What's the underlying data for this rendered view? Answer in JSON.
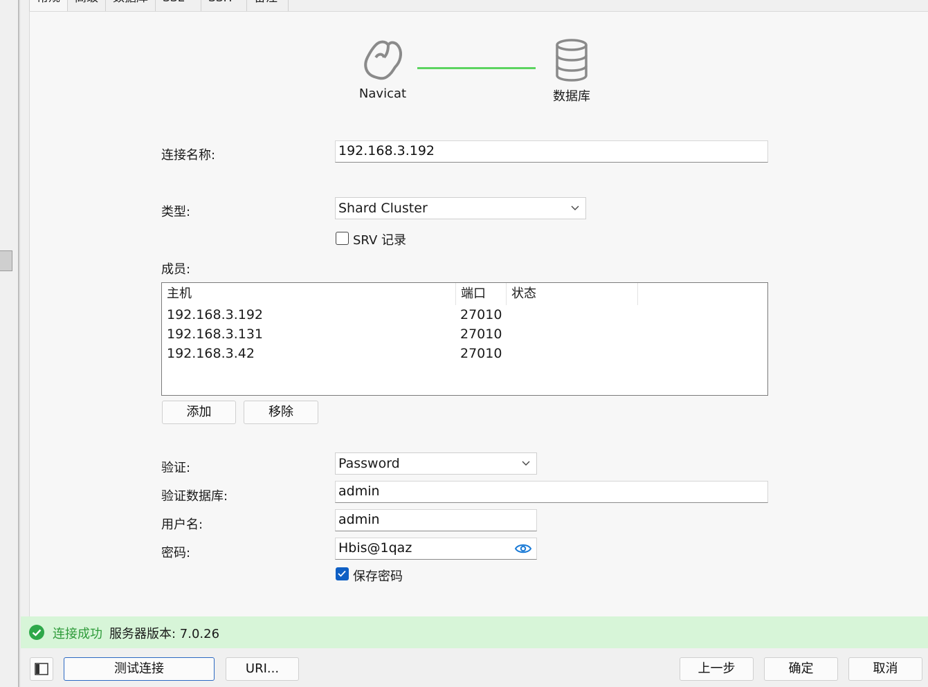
{
  "tabs": [
    "常规",
    "高级",
    "数据库",
    "SSL",
    "SSH",
    "备注"
  ],
  "header": {
    "left_caption": "Navicat",
    "right_caption": "数据库"
  },
  "form": {
    "connection_name_label": "连接名称:",
    "connection_name_value": "192.168.3.192",
    "type_label": "类型:",
    "type_value": "Shard Cluster",
    "srv_label": "SRV 记录",
    "srv_checked": false,
    "members_label": "成员:",
    "members_columns": [
      "主机",
      "端口",
      "状态"
    ],
    "members": [
      {
        "host": "192.168.3.192",
        "port": "27010",
        "status": ""
      },
      {
        "host": "192.168.3.131",
        "port": "27010",
        "status": ""
      },
      {
        "host": "192.168.3.42",
        "port": "27010",
        "status": ""
      }
    ],
    "add_label": "添加",
    "remove_label": "移除",
    "auth_label": "验证:",
    "auth_value": "Password",
    "auth_db_label": "验证数据库:",
    "auth_db_value": "admin",
    "username_label": "用户名:",
    "username_value": "admin",
    "password_label": "密码:",
    "password_value": "Hbis@1qaz",
    "save_password_label": "保存密码",
    "save_password_checked": true
  },
  "status": {
    "message": "连接成功",
    "version": "服务器版本: 7.0.26"
  },
  "footer": {
    "test_label": "测试连接",
    "uri_label": "URI...",
    "prev_label": "上一步",
    "ok_label": "确定",
    "cancel_label": "取消"
  },
  "colors": {
    "success": "#2e9b3a",
    "connection_line": "#5cd460",
    "accent": "#0f5fc4"
  }
}
